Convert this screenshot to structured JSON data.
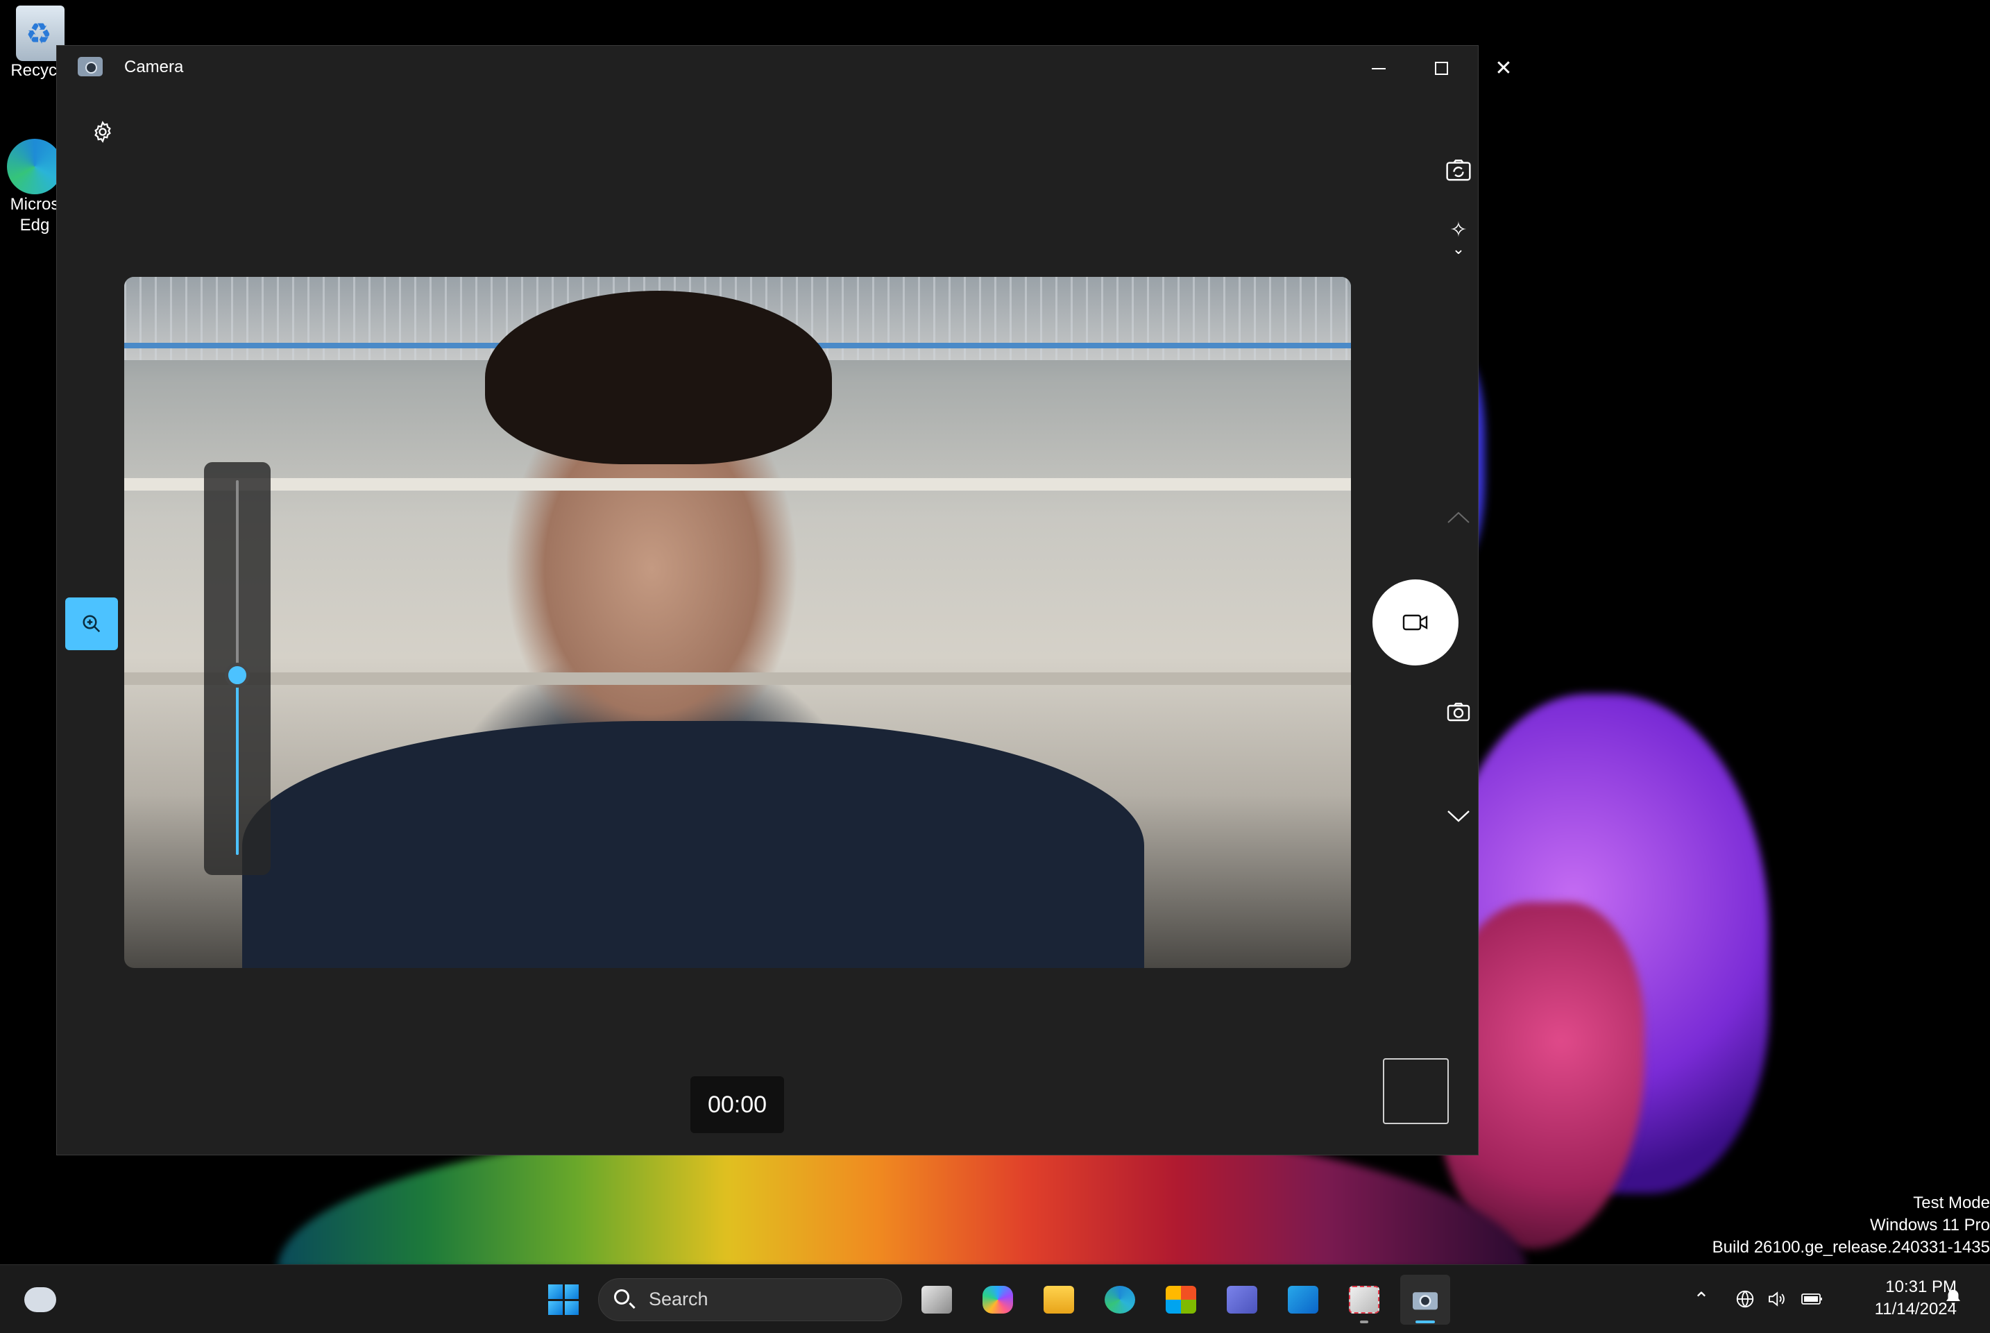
{
  "desktop": {
    "icons": [
      {
        "label": "Recycle"
      },
      {
        "label": "Micros\nEdg"
      }
    ],
    "watermark": {
      "line1": "Test Mode",
      "line2": "Windows 11 Pro",
      "line3": "Build 26100.ge_release.240331-1435"
    }
  },
  "window": {
    "title": "Camera",
    "controls": {
      "minimize": "minimize",
      "maximize": "maximize",
      "close": "close"
    }
  },
  "camera": {
    "zoom_level": 0.48,
    "timer": "00:00",
    "mode": "video",
    "icons": {
      "settings": "gear-icon",
      "switch_camera": "switch-camera-icon",
      "effects": "sparkle-icon",
      "zoom": "zoom-in-icon",
      "capture": "video-camera-icon",
      "photo": "camera-icon"
    }
  },
  "taskbar": {
    "search_placeholder": "Search",
    "apps": [
      "Task View",
      "Copilot",
      "File Explorer",
      "Microsoft Edge",
      "Microsoft Store",
      "Teams",
      "Outlook (new)",
      "Snipping Tool",
      "Camera"
    ],
    "clock": {
      "time": "10:31 PM",
      "date": "11/14/2024"
    }
  },
  "colors": {
    "accent": "#4cc2ff",
    "window_bg": "#202020",
    "taskbar_bg": "#1b1b1b"
  }
}
